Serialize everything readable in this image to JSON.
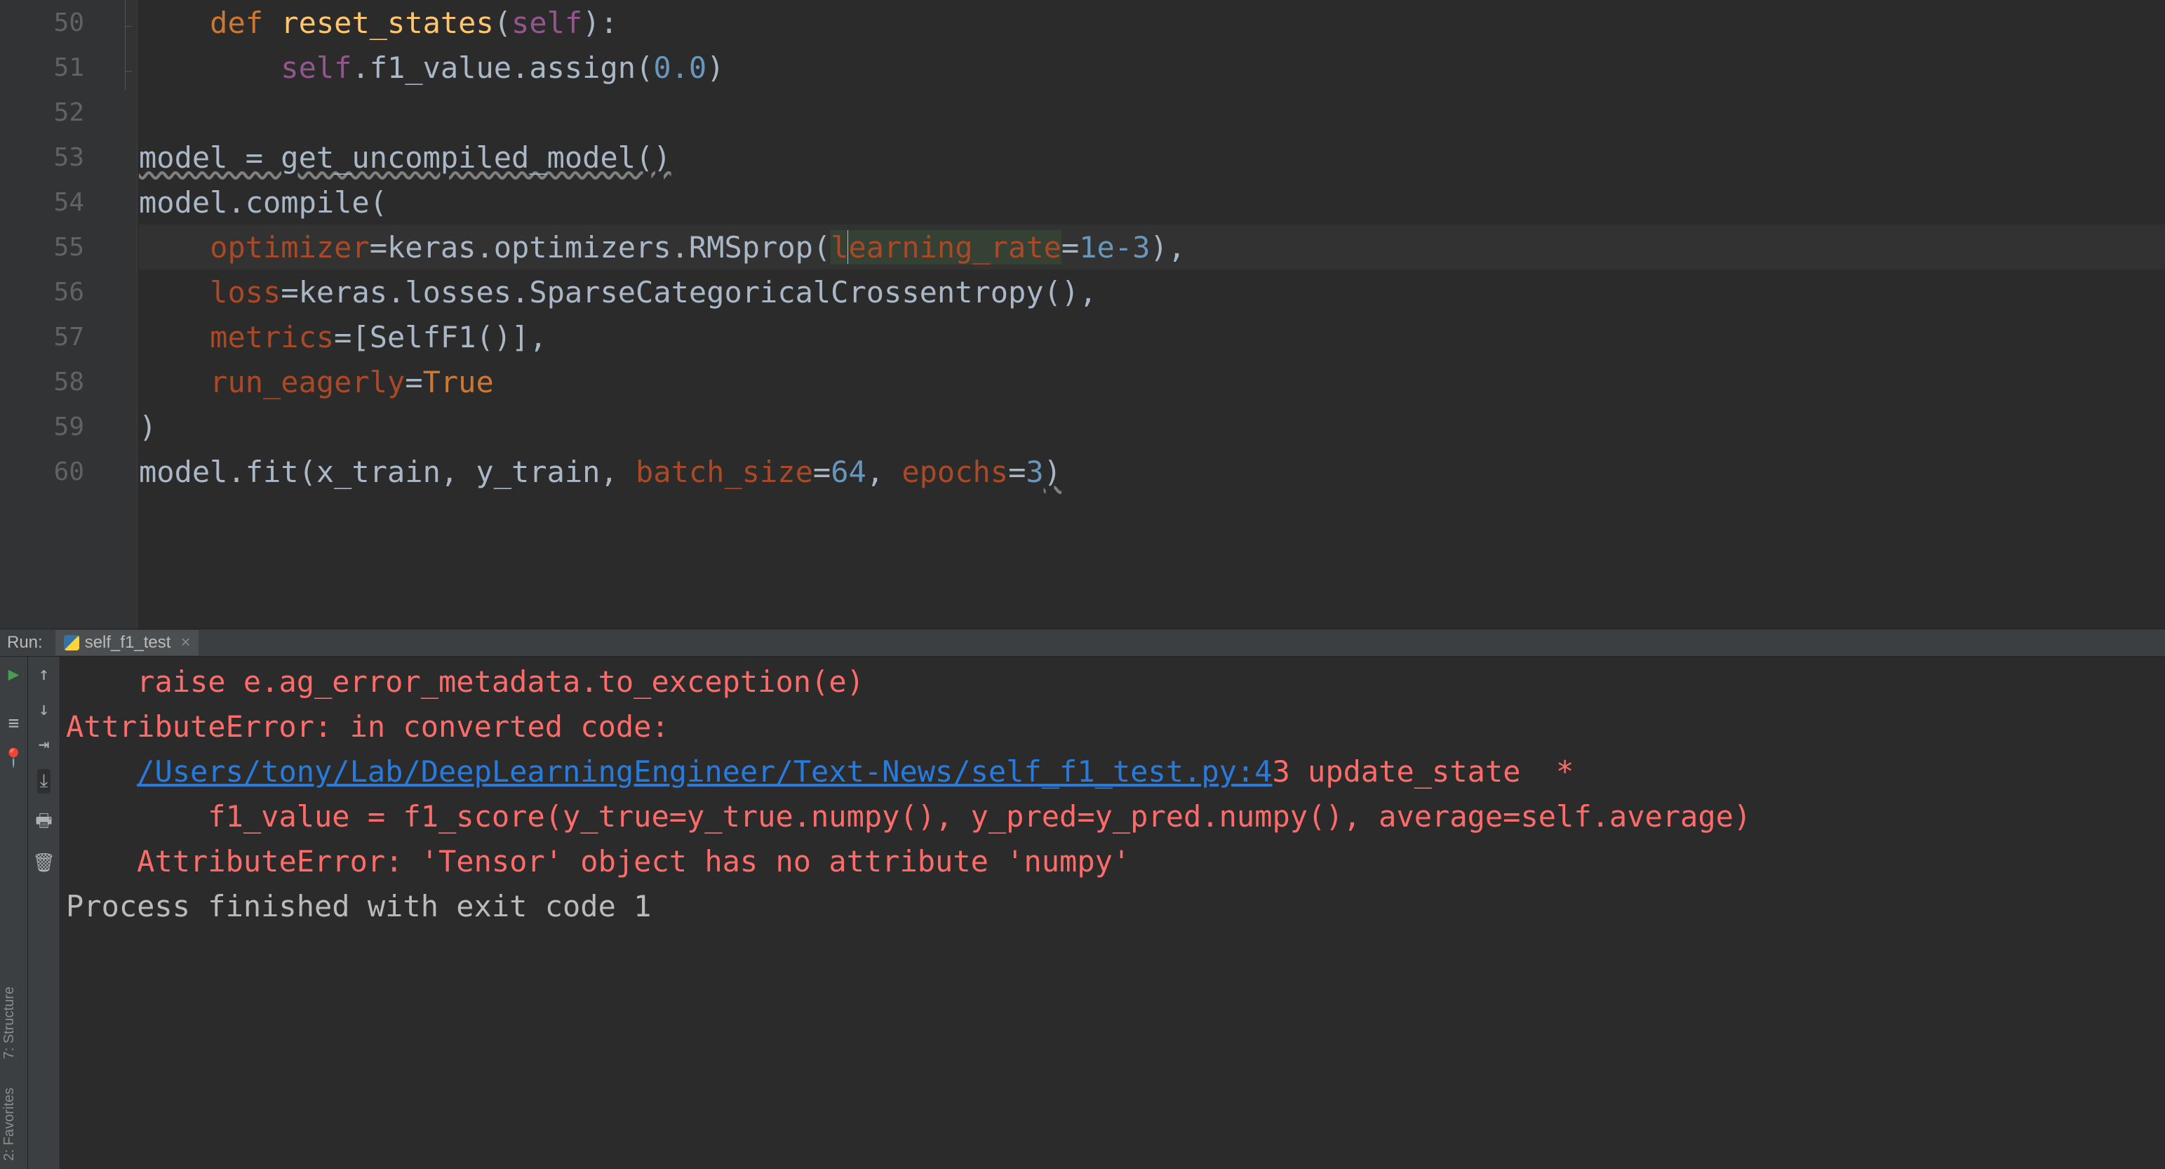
{
  "editor": {
    "lines": [
      {
        "n": 50,
        "tokens": [
          {
            "t": "    ",
            "c": "txt"
          },
          {
            "t": "def ",
            "c": "kw"
          },
          {
            "t": "reset_states",
            "c": "fn"
          },
          {
            "t": "(",
            "c": "txt"
          },
          {
            "t": "self",
            "c": "sf"
          },
          {
            "t": "):",
            "c": "txt"
          }
        ],
        "fold": "line",
        "foldEnd": true
      },
      {
        "n": 51,
        "tokens": [
          {
            "t": "        ",
            "c": "txt"
          },
          {
            "t": "self",
            "c": "sf"
          },
          {
            "t": ".f1_value.",
            "c": "txt"
          },
          {
            "t": "assign",
            "c": "txt"
          },
          {
            "t": "(",
            "c": "txt"
          },
          {
            "t": "0.0",
            "c": "num"
          },
          {
            "t": ")",
            "c": "txt"
          }
        ],
        "fold": "line",
        "foldEnd": true
      },
      {
        "n": 52,
        "tokens": []
      },
      {
        "n": 53,
        "tokens": [
          {
            "t": "model = get_uncompiled_model()",
            "c": "txt",
            "wavy": true
          }
        ]
      },
      {
        "n": 54,
        "tokens": [
          {
            "t": "model.compile(",
            "c": "txt"
          }
        ]
      },
      {
        "n": 55,
        "sel": true,
        "tokens": [
          {
            "t": "    ",
            "c": "txt"
          },
          {
            "t": "optimizer",
            "c": "kwr"
          },
          {
            "t": "=keras.optimizers.RMSprop(",
            "c": "txt"
          },
          {
            "t": "l",
            "c": "kwr",
            "argSel": true,
            "caretAfter": true
          },
          {
            "t": "earning_rate",
            "c": "kwr",
            "argSel": true
          },
          {
            "t": "=",
            "c": "txt"
          },
          {
            "t": "1e-3",
            "c": "num"
          },
          {
            "t": "),",
            "c": "txt"
          }
        ]
      },
      {
        "n": 56,
        "tokens": [
          {
            "t": "    ",
            "c": "txt"
          },
          {
            "t": "loss",
            "c": "kwr"
          },
          {
            "t": "=keras.losses.SparseCategoricalCrossentropy(),",
            "c": "txt"
          }
        ]
      },
      {
        "n": 57,
        "tokens": [
          {
            "t": "    ",
            "c": "txt"
          },
          {
            "t": "metrics",
            "c": "kwr"
          },
          {
            "t": "=[SelfF1()],",
            "c": "txt"
          }
        ]
      },
      {
        "n": 58,
        "tokens": [
          {
            "t": "    ",
            "c": "txt"
          },
          {
            "t": "run_eagerly",
            "c": "kwr"
          },
          {
            "t": "=",
            "c": "txt"
          },
          {
            "t": "True",
            "c": "kw"
          }
        ]
      },
      {
        "n": 59,
        "tokens": [
          {
            "t": ")",
            "c": "txt"
          }
        ]
      },
      {
        "n": 60,
        "tokens": [
          {
            "t": "model.fit(x_train, y_train, ",
            "c": "txt"
          },
          {
            "t": "batch_size",
            "c": "kwr"
          },
          {
            "t": "=",
            "c": "txt"
          },
          {
            "t": "64",
            "c": "num"
          },
          {
            "t": ", ",
            "c": "txt"
          },
          {
            "t": "epochs",
            "c": "kwr"
          },
          {
            "t": "=",
            "c": "txt"
          },
          {
            "t": "3",
            "c": "num"
          },
          {
            "t": ")",
            "c": "txt",
            "wavy": true
          }
        ]
      }
    ]
  },
  "run": {
    "label": "Run:",
    "tab": "self_f1_test",
    "toolbar1": {
      "play": "▶",
      "stop": "■",
      "layout": "≡",
      "pin": "📌"
    },
    "toolbar2": {
      "up": "↑",
      "down": "↓",
      "wrap": "⇥",
      "scroll": "⤓",
      "print": "🖨",
      "trash": "🗑"
    },
    "lines": [
      {
        "cls": "err",
        "pre": "    ",
        "text": "raise e.ag_error_metadata.to_exception(e)"
      },
      {
        "cls": "err",
        "pre": "",
        "text": "AttributeError: in converted code:"
      },
      {
        "cls": "err",
        "pre": "",
        "text": ""
      },
      {
        "cls": "err",
        "pre": "    ",
        "link": "/Users/tony/Lab/DeepLearningEngineer/Text-News/self_f1_test.py:4",
        "after": "3 update_state  *"
      },
      {
        "cls": "err",
        "pre": "        ",
        "text": "f1_value = f1_score(y_true=y_true.numpy(), y_pred=y_pred.numpy(), average=self.average)"
      },
      {
        "cls": "err",
        "pre": "",
        "text": ""
      },
      {
        "cls": "err",
        "pre": "    ",
        "text": "AttributeError: 'Tensor' object has no attribute 'numpy'"
      },
      {
        "cls": "out",
        "pre": "",
        "text": ""
      },
      {
        "cls": "out",
        "pre": "",
        "text": ""
      },
      {
        "cls": "out",
        "pre": "",
        "text": "Process finished with exit code 1"
      }
    ]
  },
  "sideTabs": {
    "structure": "7: Structure",
    "favorites": "2: Favorites"
  }
}
